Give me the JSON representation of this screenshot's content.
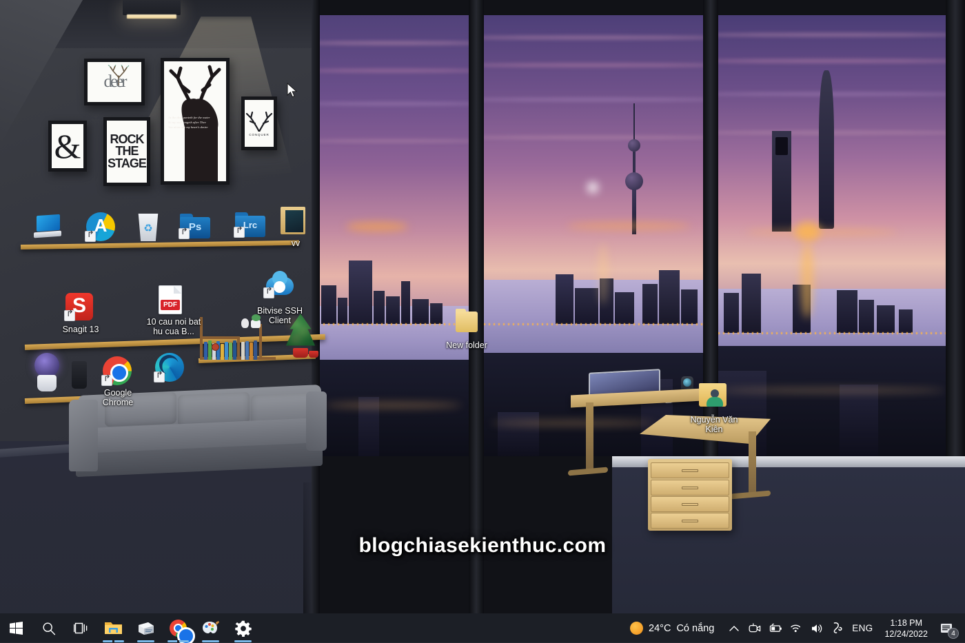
{
  "desktop": {
    "watermark": "blogchiasekienthuc.com",
    "icons": [
      {
        "name": "this-pc",
        "label": "",
        "type": "monitor"
      },
      {
        "name": "autodesk",
        "label": "",
        "type": "acrobat-a"
      },
      {
        "name": "recycle-bin",
        "label": "",
        "type": "recycle-bin"
      },
      {
        "name": "photoshop",
        "label": "",
        "type": "folder-ps",
        "folder_text": "Ps"
      },
      {
        "name": "lightroom",
        "label": "",
        "type": "folder-lrc",
        "folder_text": "Lrc"
      },
      {
        "name": "vv-folder",
        "label": "vv",
        "type": "folder-thumb"
      },
      {
        "name": "snagit",
        "label": "Snagit 13",
        "type": "snagit"
      },
      {
        "name": "pdf-document",
        "label": "10 cau noi bat hu cua B...",
        "type": "pdf"
      },
      {
        "name": "bitvise-ssh",
        "label": "Bitvise SSH Client",
        "type": "cloud-user"
      },
      {
        "name": "google-chrome",
        "label": "Google Chrome",
        "type": "chrome"
      },
      {
        "name": "microsoft-edge",
        "label": "",
        "type": "edge"
      },
      {
        "name": "new-folder",
        "label": "New folder",
        "type": "folder-plain"
      },
      {
        "name": "user-folder",
        "label": "Nguyễn Văn Kiên",
        "type": "user-folder"
      }
    ]
  },
  "wall_art": {
    "deer_word": "deer",
    "ampersand": "&",
    "rock_lines": [
      "ROCK",
      "THE",
      "STAGE"
    ],
    "antler_caption": "CONQUER",
    "stag_script": "As the deer panteth for the water So my soul longeth after Thee You alone are my heart's desire"
  },
  "taskbar": {
    "start_label": "Start",
    "search_label": "Search",
    "taskview_label": "Task View",
    "pinned": [
      {
        "name": "file-explorer",
        "label": "File Explorer",
        "running": true,
        "grouped": true
      },
      {
        "name": "unikey",
        "label": "UniKey",
        "running": true,
        "grouped": false
      },
      {
        "name": "chrome",
        "label": "Google Chrome",
        "running": true,
        "grouped": true
      },
      {
        "name": "paint-3d",
        "label": "Paint 3D",
        "running": true,
        "grouped": false
      },
      {
        "name": "settings",
        "label": "Settings",
        "running": true,
        "grouped": false
      }
    ],
    "weather": {
      "temperature": "24°C",
      "condition": "Có nắng"
    },
    "tray": [
      {
        "name": "show-hidden-icons",
        "glyph": "chevron-up"
      },
      {
        "name": "camera-privacy",
        "glyph": "camera"
      },
      {
        "name": "battery",
        "glyph": "battery"
      },
      {
        "name": "network-wifi",
        "glyph": "wifi"
      },
      {
        "name": "volume",
        "glyph": "speaker"
      },
      {
        "name": "unikey-tray",
        "glyph": "unikey"
      }
    ],
    "language": "ENG",
    "clock": {
      "time": "1:18 PM",
      "date": "12/24/2022"
    },
    "notifications": {
      "count": "4"
    }
  },
  "colors": {
    "taskbar_bg": "#1c1f26",
    "accent": "#79b8e8",
    "sun": "#f0a01a",
    "shelf": "#c79c4c",
    "text": "#ffffff"
  }
}
